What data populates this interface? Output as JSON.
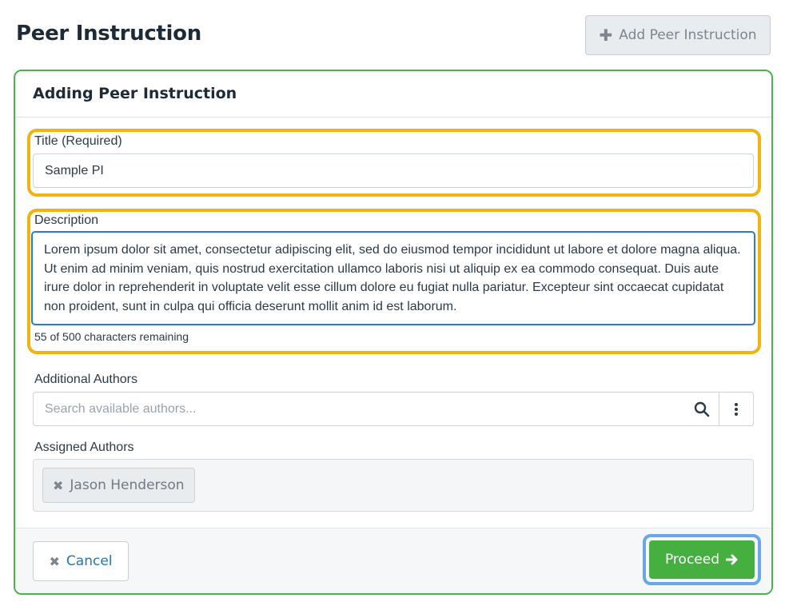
{
  "page": {
    "title": "Peer Instruction",
    "add_button_label": "Add Peer Instruction"
  },
  "card": {
    "title": "Adding Peer Instruction",
    "title_field": {
      "label": "Title (Required)",
      "value": "Sample PI"
    },
    "description_field": {
      "label": "Description",
      "value": "Lorem ipsum dolor sit amet, consectetur adipiscing elit, sed do eiusmod tempor incididunt ut labore et dolore magna aliqua. Ut enim ad minim veniam, quis nostrud exercitation ullamco laboris nisi ut aliquip ex ea commodo consequat. Duis aute irure dolor in reprehenderit in voluptate velit esse cillum dolore eu fugiat nulla pariatur. Excepteur sint occaecat cupidatat non proident, sunt in culpa qui officia deserunt mollit anim id est laborum.",
      "counter": "55 of 500 characters remaining"
    },
    "additional_authors": {
      "label": "Additional Authors",
      "placeholder": "Search available authors..."
    },
    "assigned_authors": {
      "label": "Assigned Authors",
      "items": [
        {
          "name": "Jason Henderson"
        }
      ]
    },
    "footer": {
      "cancel_label": "Cancel",
      "proceed_label": "Proceed"
    }
  },
  "colors": {
    "card_border": "#4eb24a",
    "highlight_field": "#f2b20f",
    "highlight_button": "#6aa6ea",
    "proceed": "#45b03f",
    "link": "#2176b3"
  },
  "icons": {
    "add": "plus-icon",
    "search": "search-icon",
    "menu": "vertical-dots-icon",
    "remove": "close-icon",
    "proceed": "arrow-right-icon"
  }
}
